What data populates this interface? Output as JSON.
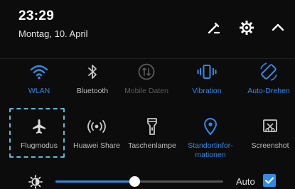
{
  "header": {
    "time": "23:29",
    "date": "Montag, 10. April"
  },
  "tiles_row1": [
    {
      "label": "WLAN",
      "icon": "wifi-icon",
      "state": "on"
    },
    {
      "label": "Bluetooth",
      "icon": "bluetooth-icon",
      "state": "off"
    },
    {
      "label": "Mobile Daten",
      "icon": "mobile-data-icon",
      "state": "disabled"
    },
    {
      "label": "Vibration",
      "icon": "vibration-icon",
      "state": "on"
    },
    {
      "label": "Auto-Drehen",
      "icon": "auto-rotate-icon",
      "state": "on"
    }
  ],
  "tiles_row2": [
    {
      "label": "Flugmodus",
      "icon": "airplane-icon",
      "state": "off"
    },
    {
      "label": "Huawei Share",
      "icon": "huawei-share-icon",
      "state": "off"
    },
    {
      "label": "Taschenlampe",
      "icon": "flashlight-icon",
      "state": "off"
    },
    {
      "label": "Standortinfor-\nmationen",
      "icon": "location-icon",
      "state": "on"
    },
    {
      "label": "Screenshot",
      "icon": "screenshot-icon",
      "state": "off"
    }
  ],
  "brightness": {
    "auto_label": "Auto",
    "auto_checked": true,
    "level": 0.47
  },
  "colors": {
    "accent": "#2f8be8",
    "off": "#bcbcbc",
    "disabled": "#5a5a5a",
    "focus_outline": "#5fb8d8"
  }
}
